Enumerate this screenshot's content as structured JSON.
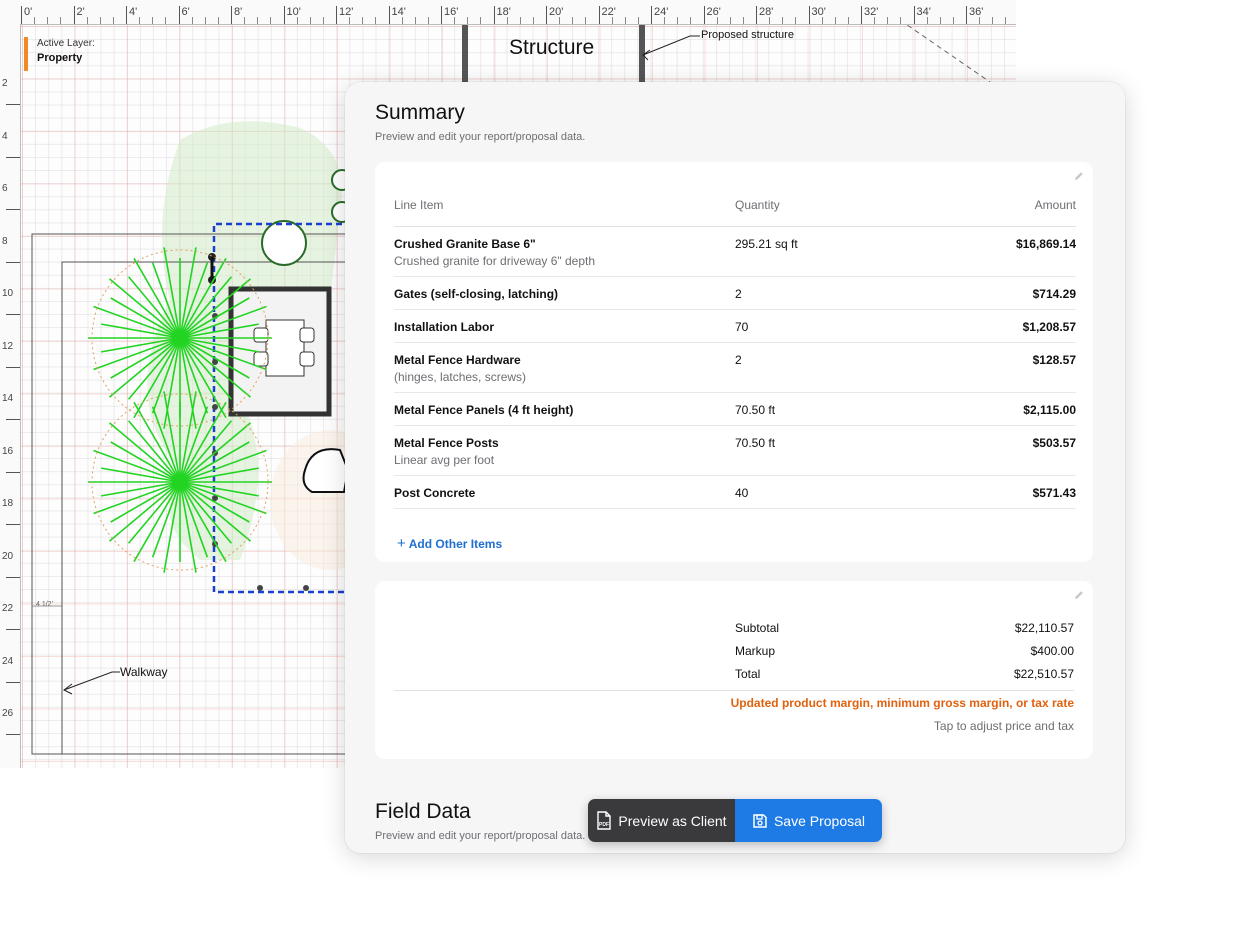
{
  "plan": {
    "active_layer_label": "Active Layer:",
    "active_layer_value": "Property",
    "structure_label": "Structure",
    "proposed_structure_label": "Proposed structure",
    "walkway_label": "Walkway",
    "dimension_label": "4 1/2'",
    "ruler_top": [
      "0'",
      "2'",
      "4'",
      "6'",
      "8'",
      "10'",
      "12'",
      "14'",
      "16'",
      "18'",
      "20'",
      "22'",
      "24'",
      "26'",
      "28'",
      "30'",
      "32'",
      "34'",
      "36'"
    ],
    "ruler_left": [
      "2",
      "4",
      "6",
      "8",
      "10",
      "12",
      "14",
      "16",
      "18",
      "20",
      "22",
      "24",
      "26"
    ]
  },
  "summary": {
    "title": "Summary",
    "subtitle": "Preview and edit your report/proposal data.",
    "columns": {
      "item": "Line Item",
      "quantity": "Quantity",
      "amount": "Amount"
    },
    "line_items": [
      {
        "name": "Crushed Granite Base 6\"",
        "desc": "Crushed granite for driveway 6\" depth",
        "quantity": "295.21 sq ft",
        "amount": "$16,869.14"
      },
      {
        "name": "Gates (self-closing, latching)",
        "desc": "",
        "quantity": "2",
        "amount": "$714.29"
      },
      {
        "name": "Installation Labor",
        "desc": "",
        "quantity": "70",
        "amount": "$1,208.57"
      },
      {
        "name": "Metal Fence Hardware",
        "desc": "(hinges, latches, screws)",
        "quantity": "2",
        "amount": "$128.57"
      },
      {
        "name": "Metal Fence Panels (4 ft height)",
        "desc": "",
        "quantity": "70.50 ft",
        "amount": "$2,115.00"
      },
      {
        "name": "Metal Fence Posts",
        "desc": "Linear avg per foot",
        "quantity": "70.50 ft",
        "amount": "$503.57"
      },
      {
        "name": "Post Concrete",
        "desc": "",
        "quantity": "40",
        "amount": "$571.43"
      }
    ],
    "add_other_items": "Add Other Items",
    "totals": {
      "subtotal_label": "Subtotal",
      "subtotal": "$22,110.57",
      "markup_label": "Markup",
      "markup": "$400.00",
      "total_label": "Total",
      "total": "$22,510.57"
    },
    "notice": "Updated product margin, minimum gross margin, or tax rate",
    "tap_adjust": "Tap to adjust price and tax"
  },
  "field_data": {
    "title": "Field Data",
    "subtitle": "Preview and edit your report/proposal data."
  },
  "actions": {
    "preview_label": "Preview as Client",
    "save_label": "Save Proposal",
    "pdf_badge": "PDF"
  },
  "colors": {
    "accent_blue": "#1e7be6",
    "notice_orange": "#e0620f",
    "layer_orange": "#f08a24",
    "plant_green": "#22d422",
    "selection_blue": "#1a3fd1"
  }
}
